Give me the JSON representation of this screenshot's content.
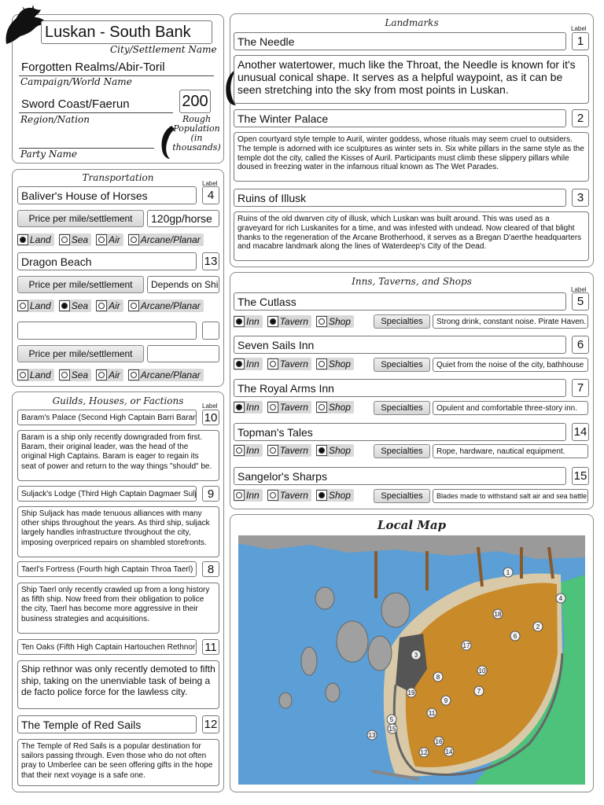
{
  "settlement": {
    "name": "Luskan - South Bank",
    "name_caption": "City/Settlement Name",
    "campaign": "Forgotten Realms/Abir-Toril",
    "campaign_caption": "Campaign/World Name",
    "region": "Sword Coast/Faerun",
    "region_caption": "Region/Nation",
    "population": "200",
    "population_caption": "Rough Population (in thousands)",
    "party_caption": "Party Name"
  },
  "transportation": {
    "heading": "Transportation",
    "label_caption": "Label",
    "price_label": "Price per mile/settlement",
    "options": [
      "Land",
      "Sea",
      "Air",
      "Arcane/Planar"
    ],
    "entries": [
      {
        "name": "Baliver's House of Horses",
        "label": "4",
        "price": "120gp/horse",
        "selected": "Land"
      },
      {
        "name": "Dragon Beach",
        "label": "13",
        "price": "Depends on Ship",
        "selected": "Sea"
      },
      {
        "name": "",
        "label": "",
        "price": "",
        "selected": ""
      }
    ]
  },
  "guilds": {
    "heading": "Guilds, Houses, or Factions",
    "label_caption": "Label",
    "entries": [
      {
        "name": "Baram's Palace (Second High Captain Barri Baram)",
        "label": "10",
        "desc": "Baram is a ship only recently downgraded from first. Baram, their original leader, was the head of the original High Captains. Baram is eager to regain its seat of power and return to the way things \"should\" be."
      },
      {
        "name": "Suljack's Lodge (Third High Captain Dagmaer Suljack)",
        "label": "9",
        "desc": "Ship Suljack has made tenuous alliances with many other ships throughout the years. As third ship, suljack largely handles infrastructure throughout the city, imposing overpriced repairs on shambled storefronts."
      },
      {
        "name": "Taerl's Fortress (Fourth high Captain Throa Taerl)",
        "label": "8",
        "desc": "Ship Taerl only recently crawled up from a long history as fifth ship. Now freed from their obligation to police the city, Taerl has become more aggressive in their business strategies and acquisitions."
      },
      {
        "name": "Ten Oaks (Fifth High Captain Hartouchen Rethnor)",
        "label": "11",
        "desc": "Ship rethnor was only recently demoted to fifth ship, taking on the unenviable task of being a de facto police force for the lawless city."
      },
      {
        "name": "The Temple of Red Sails",
        "label": "12",
        "desc": "The Temple of Red Sails is a popular destination for sailors passing through. Even those who do not often pray to Umberlee can be seen offering gifts in the hope that their next voyage is a safe one."
      }
    ]
  },
  "landmarks": {
    "heading": "Landmarks",
    "label_caption": "Label",
    "entries": [
      {
        "name": "The Needle",
        "label": "1",
        "desc": "Another watertower, much like the Throat, the Needle is known for it's unusual conical shape. It serves as a helpful waypoint, as it can be seen stretching into the sky from most points in Luskan."
      },
      {
        "name": "The Winter Palace",
        "label": "2",
        "desc": "Open courtyard style temple to Auril, winter goddess, whose rituals may seem cruel to outsiders. The temple is adorned with ice sculptures as winter sets in. Six white pillars in the same style as the temple dot the city, called the Kisses of Auril. Participants must climb these slippery pillars while doused in freezing water in the infamous ritual known as The Wet Parades."
      },
      {
        "name": "Ruins of Illusk",
        "label": "3",
        "desc": "Ruins of the old dwarven city of illusk, which Luskan was built around. This was used as a graveyard for rich Luskanites for a time, and was infested with undead. Now cleared of that blight thanks to the regeneration of the Arcane Brotherhood, it serves as a Bregan D'aerthe headquarters and macabre landmark along the lines of Waterdeep's City of the Dead."
      }
    ]
  },
  "inns": {
    "heading": "Inns, Taverns, and Shops",
    "label_caption": "Label",
    "specialties_label": "Specialties",
    "options": [
      "Inn",
      "Tavern",
      "Shop"
    ],
    "entries": [
      {
        "name": "The Cutlass",
        "label": "5",
        "checked": [
          "Inn",
          "Tavern"
        ],
        "specialties": "Strong drink, constant noise. Pirate Haven."
      },
      {
        "name": "Seven Sails Inn",
        "label": "6",
        "checked": [
          "Inn"
        ],
        "specialties": "Quiet from the noise of the city, bathhouse"
      },
      {
        "name": "The Royal Arms Inn",
        "label": "7",
        "checked": [
          "Inn"
        ],
        "specialties": "Opulent and comfortable three-story inn."
      },
      {
        "name": "Topman's Tales",
        "label": "14",
        "checked": [
          "Shop"
        ],
        "specialties": "Rope, hardware, nautical equipment."
      },
      {
        "name": "Sangelor's Sharps",
        "label": "15",
        "checked": [
          "Shop"
        ],
        "specialties": "Blades made to withstand salt air and sea battle"
      }
    ]
  },
  "map": {
    "heading": "Local Map",
    "markers": [
      "1",
      "2",
      "3",
      "4",
      "5",
      "6",
      "7",
      "8",
      "9",
      "10",
      "11",
      "12",
      "13",
      "14",
      "15",
      "16",
      "17",
      "18",
      "19"
    ]
  },
  "colors": {
    "water": "#5b9fd6",
    "city": "#c98a2a",
    "land": "#9a9a9a",
    "grass": "#4cc27a"
  }
}
